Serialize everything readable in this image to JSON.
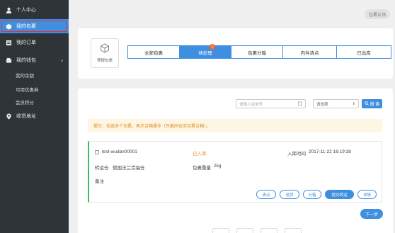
{
  "sidebar": {
    "items": [
      {
        "label": "个人中心",
        "icon": "user-icon"
      },
      {
        "label": "我的包裹",
        "icon": "box-icon"
      },
      {
        "label": "我的订单",
        "icon": "list-icon"
      },
      {
        "label": "我的钱包",
        "icon": "wallet-icon"
      },
      {
        "label": "收货地址",
        "icon": "location-icon"
      }
    ],
    "wallet_sub": [
      "我的余额",
      "可用优惠券",
      "会员积分"
    ]
  },
  "header": {
    "help_label": "包裹认领"
  },
  "predict": {
    "label": "预报包裹"
  },
  "tabs": [
    {
      "label": "全部包裹"
    },
    {
      "label": "待处理",
      "badge": "1"
    },
    {
      "label": "包裹分箱"
    },
    {
      "label": "内件清点"
    },
    {
      "label": "已出库"
    }
  ],
  "search": {
    "placeholder": "请输入运单号",
    "select_value": "请选择",
    "button_label": "搜 索"
  },
  "notice": "提示：勾选多个包裹，表示合箱操作（只能同仓库包裹合箱）。",
  "package": {
    "tracking": "test-wudan00001",
    "status": "已入库",
    "time_label": "入库时间",
    "time_value": "2017-11-22 16:19:38",
    "warehouse_label": "转运仓",
    "warehouse_value": "德国法兰克福仓",
    "weight_label": "包裹重量",
    "weight_value": "2kg",
    "note_label": "备注",
    "actions": [
      "清点",
      "退货",
      "分箱",
      "提交转运",
      "详情"
    ]
  },
  "next_label": "下一步",
  "accent": "#3f8fe0",
  "status_color": "#f08a24"
}
